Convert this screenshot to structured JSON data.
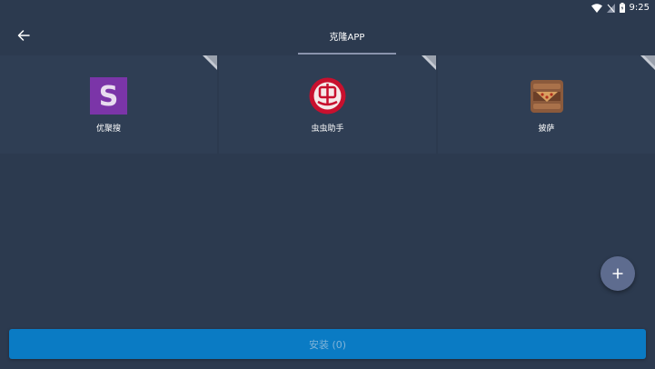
{
  "status_bar": {
    "time": "9:25",
    "icons": [
      "wifi-icon",
      "signal-off-icon",
      "battery-icon"
    ]
  },
  "toolbar": {
    "back_icon": "arrow-left-icon",
    "tab_label": "克隆APP"
  },
  "apps": [
    {
      "name": "优聚搜",
      "icon": "youjusou-app-icon",
      "color": "#7b35a8"
    },
    {
      "name": "虫虫助手",
      "icon": "chongchong-app-icon",
      "color": "#c8102e"
    },
    {
      "name": "披萨",
      "icon": "pizza-app-icon",
      "color": "#8b5a3c"
    }
  ],
  "fab": {
    "icon": "plus-icon"
  },
  "install": {
    "label": "安装 (0)"
  },
  "colors": {
    "background": "#2c3a4f",
    "cell": "#2f3e54",
    "accent": "#0a7bc4",
    "fab": "#5e6c8f"
  }
}
